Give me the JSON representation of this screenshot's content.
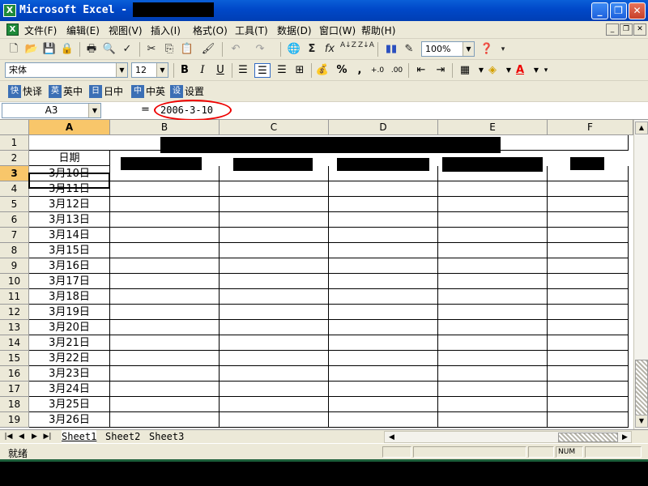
{
  "window": {
    "title": "Microsoft Excel -"
  },
  "menu": {
    "items": [
      "文件(F)",
      "编辑(E)",
      "视图(V)",
      "插入(I)",
      "格式(O)",
      "工具(T)",
      "数据(D)",
      "窗口(W)",
      "帮助(H)"
    ]
  },
  "toolbar": {
    "zoom": "100%"
  },
  "format": {
    "font": "宋体",
    "size": "12",
    "bold": "B",
    "italic": "I",
    "underline": "U",
    "percent": "%",
    "comma": ","
  },
  "ime": {
    "items": [
      "快译",
      "英中",
      "日中",
      "中英",
      "设置"
    ]
  },
  "formula": {
    "name_box": "A3",
    "equals": "=",
    "value": "2006-3-10"
  },
  "grid": {
    "columns": [
      "A",
      "B",
      "C",
      "D",
      "E",
      "F"
    ],
    "rows": [
      "1",
      "2",
      "3",
      "4",
      "5",
      "6",
      "7",
      "8",
      "9",
      "10",
      "11",
      "12",
      "13",
      "14",
      "15",
      "16",
      "17",
      "18",
      "19"
    ],
    "a2": "日期",
    "dates": [
      "3月10日",
      "3月11日",
      "3月12日",
      "3月13日",
      "3月14日",
      "3月15日",
      "3月16日",
      "3月17日",
      "3月18日",
      "3月19日",
      "3月20日",
      "3月21日",
      "3月22日",
      "3月23日",
      "3月24日",
      "3月25日",
      "3月26日"
    ]
  },
  "sheets": [
    "Sheet1",
    "Sheet2",
    "Sheet3"
  ],
  "status": {
    "text": "就绪",
    "num": "NUM"
  }
}
